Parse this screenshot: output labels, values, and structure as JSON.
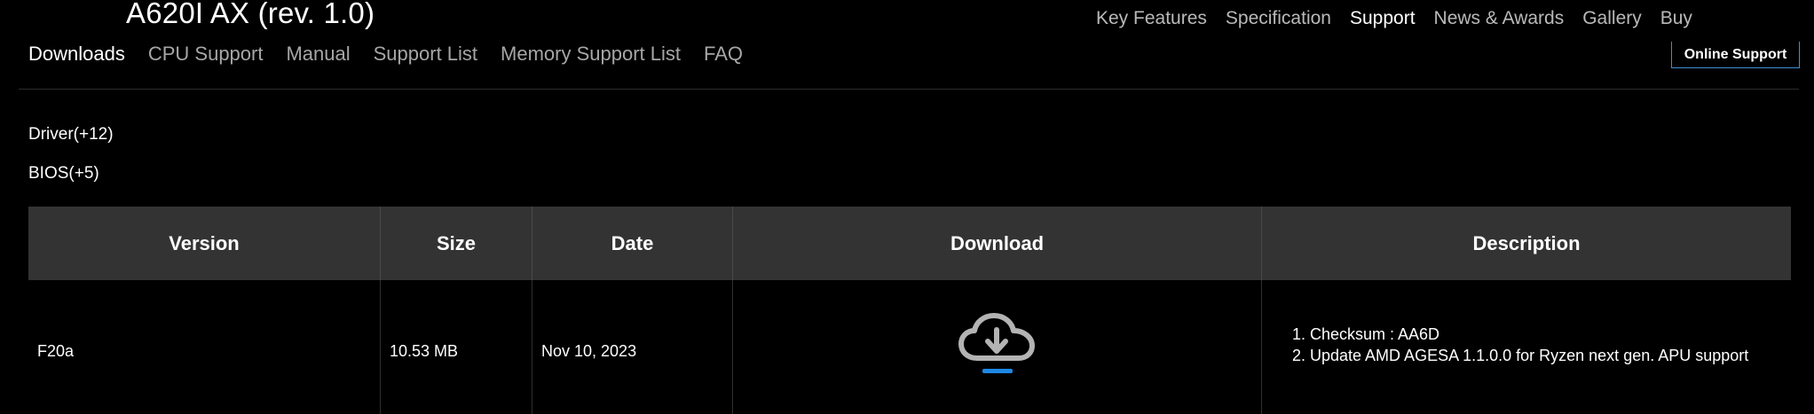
{
  "product": {
    "title": "A620I AX (rev. 1.0)"
  },
  "top_nav": [
    {
      "label": "Key Features"
    },
    {
      "label": "Specification"
    },
    {
      "label": "Support"
    },
    {
      "label": "News & Awards"
    },
    {
      "label": "Gallery"
    },
    {
      "label": "Buy"
    }
  ],
  "sub_nav": [
    {
      "label": "Downloads"
    },
    {
      "label": "CPU Support"
    },
    {
      "label": "Manual"
    },
    {
      "label": "Support List"
    },
    {
      "label": "Memory Support List"
    },
    {
      "label": "FAQ"
    }
  ],
  "online_support": {
    "label": "Online Support"
  },
  "categories": {
    "driver": "Driver(+12)",
    "bios": "BIOS(+5)"
  },
  "table": {
    "headers": [
      "Version",
      "Size",
      "Date",
      "Download",
      "Description"
    ],
    "rows": [
      {
        "version": "F20a",
        "size": "10.53 MB",
        "date": "Nov 10, 2023",
        "download_icon": "cloud-download-icon",
        "description": [
          "Checksum : AA6D",
          "Update AMD AGESA 1.1.0.0 for Ryzen next gen. APU support"
        ]
      }
    ]
  },
  "colors": {
    "background": "#000000",
    "header_bg": "#333333",
    "accent": "#3d8fd6",
    "download_underline": "#1e88e5"
  }
}
